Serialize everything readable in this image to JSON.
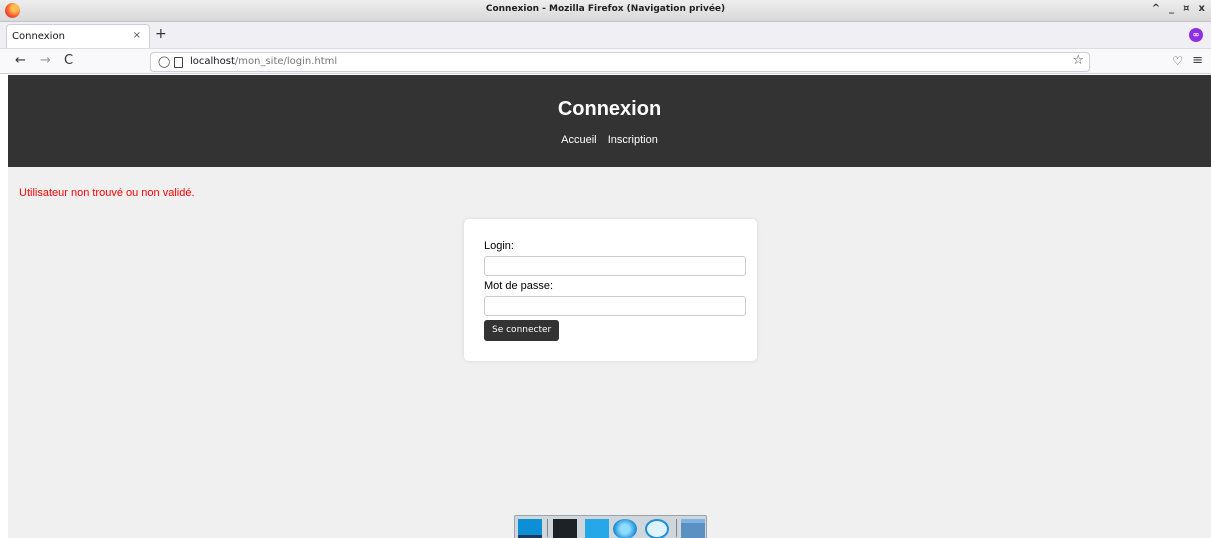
{
  "window": {
    "title": "Connexion - Mozilla Firefox (Navigation privée)",
    "controls": [
      "^",
      "_",
      "¤",
      "x"
    ]
  },
  "tab": {
    "label": "Connexion",
    "close": "×",
    "new_tab": "+"
  },
  "nav": {
    "back": "←",
    "forward": "→",
    "reload": "C",
    "url_host": "localhost",
    "url_path": "/mon_site/login.html",
    "bookmark": "☆",
    "pocket": "♡",
    "menu": "≡"
  },
  "site": {
    "title": "Connexion",
    "nav": [
      "Accueil",
      "Inscription"
    ],
    "error": "Utilisateur non trouvé ou non validé.",
    "form": {
      "login_label": "Login:",
      "login_value": "",
      "password_label": "Mot de passe:",
      "password_value": "",
      "submit_label": "Se connecter"
    }
  },
  "colors": {
    "header_bg": "#333333",
    "page_bg": "#f0f0f0",
    "error": "#ff0000",
    "button_bg": "#333333"
  },
  "dock": {
    "icons": [
      "desktop-icon",
      "terminal-icon",
      "file-manager-icon",
      "browser-icon",
      "search-icon",
      "folder-icon"
    ]
  }
}
